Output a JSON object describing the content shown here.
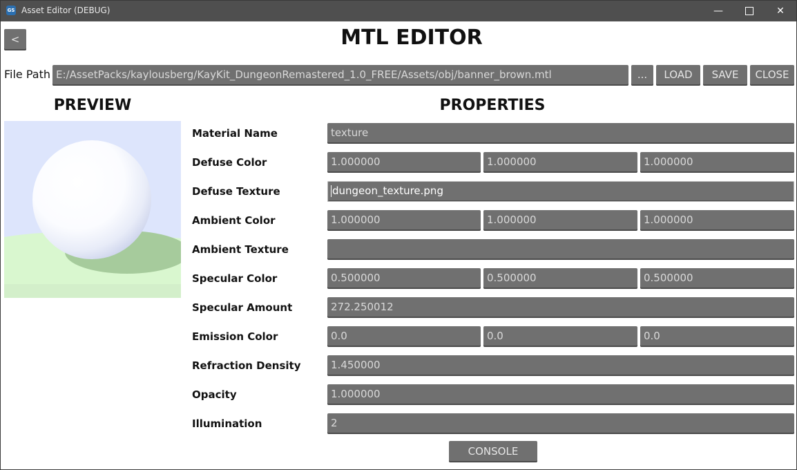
{
  "window": {
    "title": "Asset Editor (DEBUG)",
    "icon_text": "GS",
    "minimize_glyph": "—",
    "close_glyph": "✕"
  },
  "header": {
    "back_label": "<",
    "title": "MTL EDITOR"
  },
  "file": {
    "label": "File Path",
    "path": "E:/AssetPacks/kaylousberg/KayKit_DungeonRemastered_1.0_FREE/Assets/obj/banner_brown.mtl",
    "browse_label": "...",
    "load_label": "LOAD",
    "save_label": "SAVE",
    "close_label": "CLOSE"
  },
  "preview": {
    "heading": "PREVIEW"
  },
  "properties": {
    "heading": "PROPERTIES",
    "material_name": {
      "label": "Material Name",
      "value": "texture"
    },
    "defuse_color": {
      "label": "Defuse Color",
      "values": [
        "1.000000",
        "1.000000",
        "1.000000"
      ]
    },
    "defuse_texture": {
      "label": "Defuse Texture",
      "value": "dungeon_texture.png"
    },
    "ambient_color": {
      "label": "Ambient Color",
      "values": [
        "1.000000",
        "1.000000",
        "1.000000"
      ]
    },
    "ambient_texture": {
      "label": "Ambient Texture",
      "value": ""
    },
    "specular_color": {
      "label": "Specular Color",
      "values": [
        "0.500000",
        "0.500000",
        "0.500000"
      ]
    },
    "specular_amount": {
      "label": "Specular Amount",
      "value": "272.250012"
    },
    "emission_color": {
      "label": "Emission Color",
      "values": [
        "0.0",
        "0.0",
        "0.0"
      ]
    },
    "refraction_density": {
      "label": "Refraction Density",
      "value": "1.450000"
    },
    "opacity": {
      "label": "Opacity",
      "value": "1.000000"
    },
    "illumination": {
      "label": "Illumination",
      "value": "2"
    }
  },
  "footer": {
    "console_label": "CONSOLE"
  },
  "colors": {
    "field_bg": "#707070",
    "field_text": "#d9d9d9",
    "title_bar": "#4f4f4f",
    "preview_sky": "#dde5fc",
    "preview_ground": "#d9f7cf"
  }
}
